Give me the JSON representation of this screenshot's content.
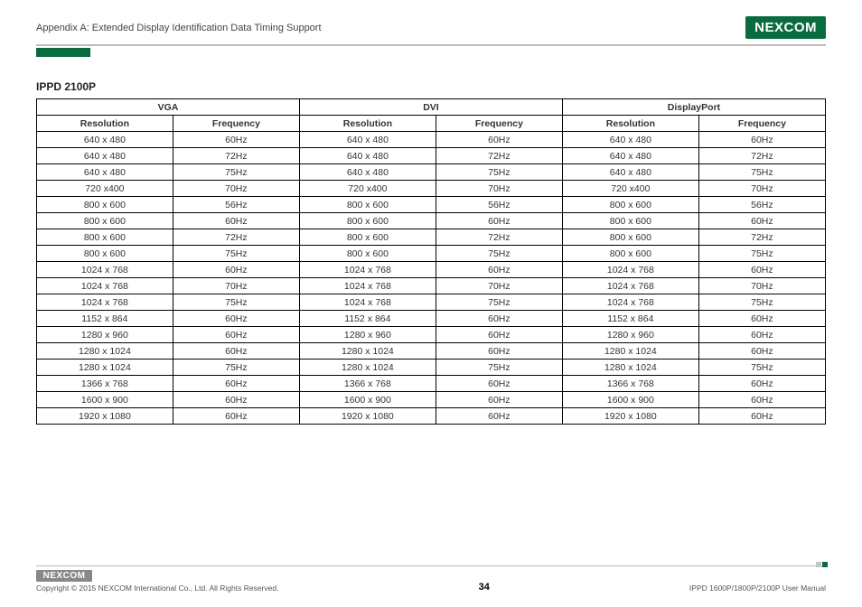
{
  "header": {
    "appendix_title": "Appendix A: Extended Display Identification Data Timing Support",
    "brand": "NEXCOM"
  },
  "model": "IPPD 2100P",
  "table": {
    "groups": [
      "VGA",
      "DVI",
      "DisplayPort"
    ],
    "subheaders": [
      "Resolution",
      "Frequency",
      "Resolution",
      "Frequency",
      "Resolution",
      "Frequency"
    ],
    "rows": [
      [
        "640 x 480",
        "60Hz",
        "640 x 480",
        "60Hz",
        "640 x 480",
        "60Hz"
      ],
      [
        "640 x 480",
        "72Hz",
        "640 x 480",
        "72Hz",
        "640 x 480",
        "72Hz"
      ],
      [
        "640 x 480",
        "75Hz",
        "640 x 480",
        "75Hz",
        "640 x 480",
        "75Hz"
      ],
      [
        "720 x400",
        "70Hz",
        "720 x400",
        "70Hz",
        "720 x400",
        "70Hz"
      ],
      [
        "800 x 600",
        "56Hz",
        "800 x 600",
        "56Hz",
        "800 x 600",
        "56Hz"
      ],
      [
        "800 x 600",
        "60Hz",
        "800 x 600",
        "60Hz",
        "800 x 600",
        "60Hz"
      ],
      [
        "800 x 600",
        "72Hz",
        "800 x 600",
        "72Hz",
        "800 x 600",
        "72Hz"
      ],
      [
        "800 x 600",
        "75Hz",
        "800 x 600",
        "75Hz",
        "800 x 600",
        "75Hz"
      ],
      [
        "1024 x 768",
        "60Hz",
        "1024 x 768",
        "60Hz",
        "1024 x 768",
        "60Hz"
      ],
      [
        "1024 x 768",
        "70Hz",
        "1024 x 768",
        "70Hz",
        "1024 x 768",
        "70Hz"
      ],
      [
        "1024 x 768",
        "75Hz",
        "1024 x 768",
        "75Hz",
        "1024 x 768",
        "75Hz"
      ],
      [
        "1152 x 864",
        "60Hz",
        "1152 x 864",
        "60Hz",
        "1152 x 864",
        "60Hz"
      ],
      [
        "1280 x 960",
        "60Hz",
        "1280 x 960",
        "60Hz",
        "1280 x 960",
        "60Hz"
      ],
      [
        "1280 x 1024",
        "60Hz",
        "1280 x 1024",
        "60Hz",
        "1280 x 1024",
        "60Hz"
      ],
      [
        "1280 x 1024",
        "75Hz",
        "1280 x 1024",
        "75Hz",
        "1280 x 1024",
        "75Hz"
      ],
      [
        "1366 x 768",
        "60Hz",
        "1366 x 768",
        "60Hz",
        "1366 x 768",
        "60Hz"
      ],
      [
        "1600 x 900",
        "60Hz",
        "1600 x 900",
        "60Hz",
        "1600 x 900",
        "60Hz"
      ],
      [
        "1920 x 1080",
        "60Hz",
        "1920 x 1080",
        "60Hz",
        "1920 x 1080",
        "60Hz"
      ]
    ]
  },
  "footer": {
    "brand": "NEXCOM",
    "copyright": "Copyright © 2015 NEXCOM International Co., Ltd. All Rights Reserved.",
    "page_number": "34",
    "manual_ref": "IPPD 1600P/1800P/2100P User Manual"
  }
}
